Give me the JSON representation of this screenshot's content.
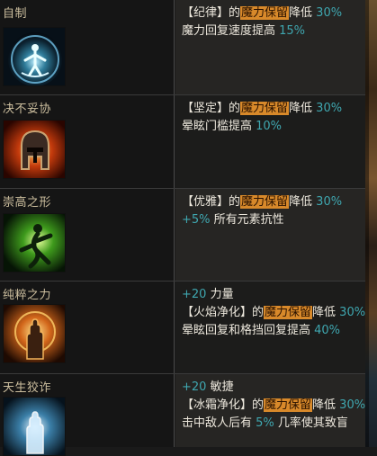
{
  "rows": [
    {
      "name": "自制",
      "icon": "meditating-figure-aura-icon",
      "lines": [
        [
          {
            "t": "【纪律】的"
          },
          {
            "t": "魔力保留",
            "hl": true
          },
          {
            "t": "降低 "
          },
          {
            "t": "30%",
            "num": true
          }
        ],
        [
          {
            "t": "魔力回复速度提高 "
          },
          {
            "t": "15%",
            "num": true
          }
        ]
      ]
    },
    {
      "name": "决不妥协",
      "icon": "fiery-helmet-icon",
      "lines": [
        [
          {
            "t": "【坚定】的"
          },
          {
            "t": "魔力保留",
            "hl": true
          },
          {
            "t": "降低 "
          },
          {
            "t": "30%",
            "num": true
          }
        ],
        [
          {
            "t": "晕眩门槛提高 "
          },
          {
            "t": "10%",
            "num": true
          }
        ]
      ]
    },
    {
      "name": "崇高之形",
      "icon": "green-dancer-icon",
      "lines": [
        [
          {
            "t": "【优雅】的"
          },
          {
            "t": "魔力保留",
            "hl": true
          },
          {
            "t": "降低 "
          },
          {
            "t": "30%",
            "num": true
          }
        ],
        [
          {
            "t": "+5%",
            "num": true
          },
          {
            "t": " 所有元素抗性"
          }
        ]
      ]
    },
    {
      "name": "纯粹之力",
      "icon": "flaming-hand-icon",
      "lines": [
        [
          {
            "t": "+20",
            "num": true
          },
          {
            "t": " 力量"
          }
        ],
        [
          {
            "t": "【火焰净化】的"
          },
          {
            "t": "魔力保留",
            "hl": true
          },
          {
            "t": "降低 "
          },
          {
            "t": "30%",
            "num": true
          }
        ],
        [
          {
            "t": "晕眩回复和格挡回复提高 "
          },
          {
            "t": "40%",
            "num": true
          }
        ]
      ]
    },
    {
      "name": "天生狡诈",
      "icon": "frost-hand-icon",
      "lines": [
        [
          {
            "t": "+20",
            "num": true
          },
          {
            "t": " 敏捷"
          }
        ],
        [
          {
            "t": "【冰霜净化】的"
          },
          {
            "t": "魔力保留",
            "hl": true
          },
          {
            "t": "降低 "
          },
          {
            "t": "30%",
            "num": true
          }
        ],
        [
          {
            "t": "击中敌人后有 "
          },
          {
            "t": "5%",
            "num": true
          },
          {
            "t": " 几率使其致盲"
          }
        ]
      ]
    }
  ]
}
